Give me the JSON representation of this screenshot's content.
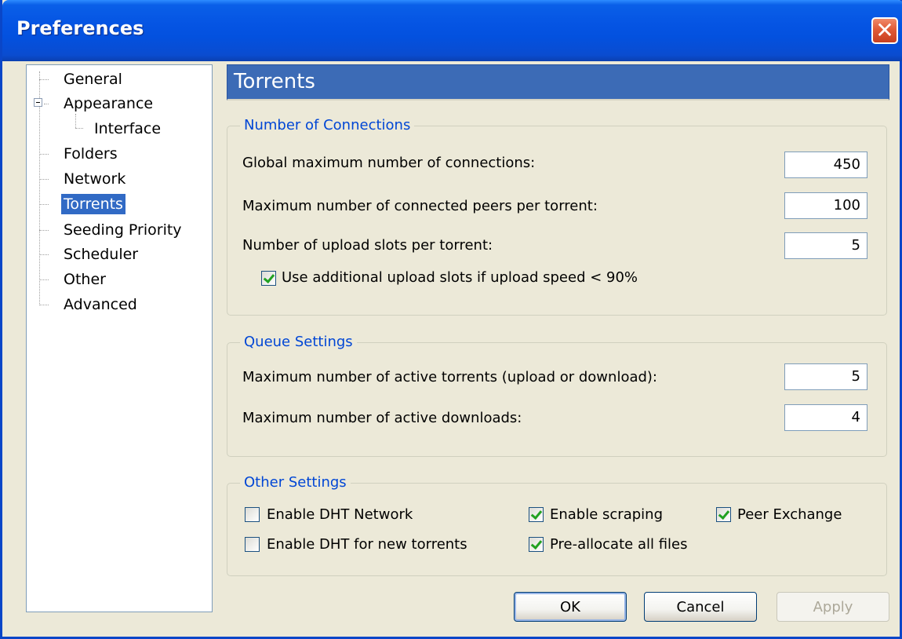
{
  "window": {
    "title": "Preferences",
    "close_label": "✕"
  },
  "sidebar": {
    "items": [
      {
        "label": "General"
      },
      {
        "label": "Appearance"
      },
      {
        "label": "Interface"
      },
      {
        "label": "Folders"
      },
      {
        "label": "Network"
      },
      {
        "label": "Torrents",
        "selected": true
      },
      {
        "label": "Seeding Priority"
      },
      {
        "label": "Scheduler"
      },
      {
        "label": "Other"
      },
      {
        "label": "Advanced"
      }
    ]
  },
  "page": {
    "title": "Torrents"
  },
  "connections": {
    "title": "Number of Connections",
    "global_max_label": "Global maximum number of connections:",
    "global_max_value": "450",
    "peers_label": "Maximum number of connected peers per torrent:",
    "peers_value": "100",
    "slots_label": "Number of upload slots per torrent:",
    "slots_value": "5",
    "additional_slots_label": "Use additional upload slots if upload speed < 90%",
    "additional_slots_checked": true
  },
  "queue": {
    "title": "Queue Settings",
    "active_torrents_label": "Maximum number of active torrents (upload or download):",
    "active_torrents_value": "5",
    "active_downloads_label": "Maximum number of active downloads:",
    "active_downloads_value": "4"
  },
  "other": {
    "title": "Other Settings",
    "dht_network_label": "Enable DHT Network",
    "dht_network_checked": false,
    "scraping_label": "Enable scraping",
    "scraping_checked": true,
    "peer_exchange_label": "Peer Exchange",
    "peer_exchange_checked": true,
    "dht_new_label": "Enable DHT for new torrents",
    "dht_new_checked": false,
    "preallocate_label": "Pre-allocate all files",
    "preallocate_checked": true
  },
  "buttons": {
    "ok": "OK",
    "cancel": "Cancel",
    "apply": "Apply"
  },
  "colors": {
    "title_bar": "#0554e3",
    "header_bar": "#3c6bb6",
    "selection": "#316ac5",
    "group_title": "#0046d5"
  }
}
